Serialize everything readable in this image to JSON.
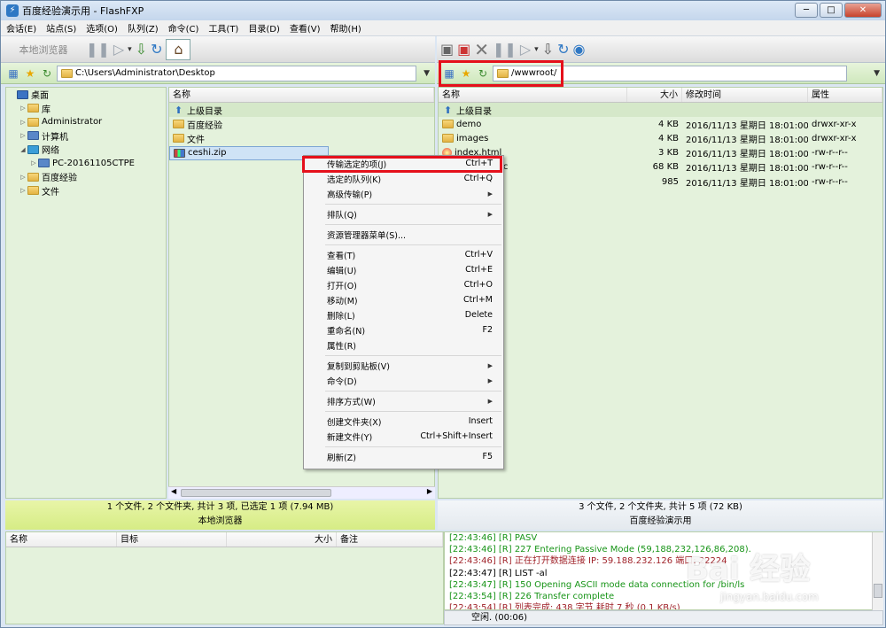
{
  "window": {
    "title": "百度经验演示用 - FlashFXP"
  },
  "menu": [
    "会话(E)",
    "站点(S)",
    "选项(O)",
    "队列(Z)",
    "命令(C)",
    "工具(T)",
    "目录(D)",
    "查看(V)",
    "帮助(H)"
  ],
  "toolbar_left": {
    "local_browser": "本地浏览器"
  },
  "local": {
    "path": "C:\\Users\\Administrator\\Desktop",
    "tree": [
      {
        "label": "桌面",
        "icon": "desktop-icon",
        "indent": 0,
        "toggle": ""
      },
      {
        "label": "库",
        "icon": "library-icon",
        "indent": 1,
        "toggle": "▷"
      },
      {
        "label": "Administrator",
        "icon": "user-folder-icon",
        "indent": 1,
        "toggle": "▷"
      },
      {
        "label": "计算机",
        "icon": "computer-icon",
        "indent": 1,
        "toggle": "▷"
      },
      {
        "label": "网络",
        "icon": "network-icon",
        "indent": 1,
        "toggle": "◢"
      },
      {
        "label": "PC-20161105CTPE",
        "icon": "pc-icon",
        "indent": 2,
        "toggle": "▷"
      },
      {
        "label": "百度经验",
        "icon": "folder-icon",
        "indent": 1,
        "toggle": "▷"
      },
      {
        "label": "文件",
        "icon": "folder-icon",
        "indent": 1,
        "toggle": "▷"
      }
    ],
    "header_name": "名称",
    "files": [
      {
        "name": "上级目录",
        "type": "up"
      },
      {
        "name": "百度经验",
        "type": "folder"
      },
      {
        "name": "文件",
        "type": "folder"
      },
      {
        "name": "ceshi.zip",
        "type": "zip"
      }
    ],
    "status_line": "1 个文件, 2 个文件夹, 共计 3 项, 已选定 1 项 (7.94 MB)",
    "status_label": "本地浏览器"
  },
  "remote": {
    "path": "/wwwroot/",
    "headers": {
      "name": "名称",
      "size": "大小",
      "modified": "修改时间",
      "attr": "属性"
    },
    "files": [
      {
        "name": "上级目录",
        "type": "up",
        "size": "",
        "modified": "",
        "attr": ""
      },
      {
        "name": "demo",
        "type": "folder",
        "size": "4 KB",
        "modified": "2016/11/13 星期日 18:01:00",
        "attr": "drwxr-xr-x"
      },
      {
        "name": "images",
        "type": "folder",
        "size": "4 KB",
        "modified": "2016/11/13 星期日 18:01:00",
        "attr": "drwxr-xr-x"
      },
      {
        "name": "index.html",
        "type": "html",
        "size": "3 KB",
        "modified": "2016/11/13 星期日 18:01:00",
        "attr": "-rw-r--r--"
      },
      {
        "name": "...anual.doc",
        "type": "doc",
        "size": "68 KB",
        "modified": "2016/11/13 星期日 18:01:00",
        "attr": "-rw-r--r--"
      },
      {
        "name": "",
        "type": "file",
        "size": "985",
        "modified": "2016/11/13 星期日 18:01:00",
        "attr": "-rw-r--r--"
      }
    ],
    "status_line": "3 个文件, 2 个文件夹, 共计 5 项 (72 KB)",
    "status_label": "百度经验演示用"
  },
  "queue": {
    "headers": {
      "name": "名称",
      "target": "目标",
      "size": "大小",
      "note": "备注"
    }
  },
  "log": [
    {
      "text": "[22:43:46] [R] PASV",
      "color": "green"
    },
    {
      "text": "[22:43:46] [R] 227 Entering Passive Mode (59,188,232,126,86,208).",
      "color": "green"
    },
    {
      "text": "[22:43:46] [R] 正在打开数据连接 IP: 59.188.232.126 端口: 22224",
      "color": "maroon"
    },
    {
      "text": "[22:43:47] [R] LIST -al",
      "color": "black"
    },
    {
      "text": "[22:43:47] [R] 150 Opening ASCII mode data connection for /bin/ls",
      "color": "green"
    },
    {
      "text": "[22:43:54] [R] 226 Transfer complete",
      "color": "green"
    },
    {
      "text": "[22:43:54] [R] 列表完成: 438 字节 耗时 7 秒 (0.1 KB/s)",
      "color": "maroon"
    }
  ],
  "log_status": "空闲. (00:06)",
  "context_menu": [
    {
      "label": "传输选定的项(J)",
      "shortcut": "Ctrl+T",
      "name": "transfer-selected"
    },
    {
      "label": "选定的队列(K)",
      "shortcut": "Ctrl+Q",
      "name": "queue-selected"
    },
    {
      "label": "高级传输(P)",
      "submenu": true,
      "name": "advanced-transfer"
    },
    {
      "sep": true
    },
    {
      "label": "排队(Q)",
      "submenu": true,
      "name": "queue"
    },
    {
      "sep": true
    },
    {
      "label": "资源管理器菜单(S)...",
      "name": "explorer-menu"
    },
    {
      "sep": true
    },
    {
      "label": "查看(T)",
      "shortcut": "Ctrl+V",
      "name": "view"
    },
    {
      "label": "编辑(U)",
      "shortcut": "Ctrl+E",
      "name": "edit"
    },
    {
      "label": "打开(O)",
      "shortcut": "Ctrl+O",
      "name": "open"
    },
    {
      "label": "移动(M)",
      "shortcut": "Ctrl+M",
      "name": "move"
    },
    {
      "label": "删除(L)",
      "shortcut": "Delete",
      "name": "delete"
    },
    {
      "label": "重命名(N)",
      "shortcut": "F2",
      "name": "rename"
    },
    {
      "label": "属性(R)",
      "name": "properties"
    },
    {
      "sep": true
    },
    {
      "label": "复制到剪贴板(V)",
      "submenu": true,
      "name": "copy-clipboard"
    },
    {
      "label": "命令(D)",
      "submenu": true,
      "name": "commands"
    },
    {
      "sep": true
    },
    {
      "label": "排序方式(W)",
      "submenu": true,
      "name": "sort-by"
    },
    {
      "sep": true
    },
    {
      "label": "创建文件夹(X)",
      "shortcut": "Insert",
      "name": "create-folder"
    },
    {
      "label": "新建文件(Y)",
      "shortcut": "Ctrl+Shift+Insert",
      "name": "new-file"
    },
    {
      "sep": true
    },
    {
      "label": "刷新(Z)",
      "shortcut": "F5",
      "name": "refresh"
    }
  ],
  "watermark": {
    "logo": "Bai 经验",
    "url": "jingyan.baidu.com"
  },
  "colors": {
    "highlight": "#e5101b",
    "pane_green": "#e4f2dc",
    "status_yellow": "#e8f5a8"
  }
}
